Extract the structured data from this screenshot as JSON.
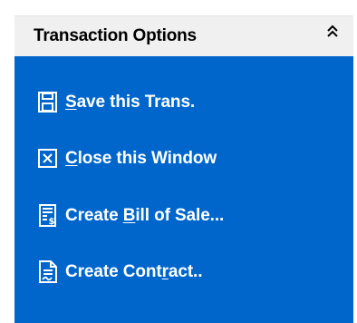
{
  "panel": {
    "title": "Transaction Options",
    "collapse_icon": "double-chevron-up-icon",
    "colors": {
      "header_bg": "#f0f0f0",
      "body_bg": "#0066cc",
      "text": "#ffffff"
    },
    "items": [
      {
        "icon": "save-disk-icon",
        "label": "Save this Trans.",
        "mnemonic_index": 0
      },
      {
        "icon": "close-box-icon",
        "label": "Close this Window",
        "mnemonic_index": 0
      },
      {
        "icon": "invoice-icon",
        "label": "Create Bill of Sale...",
        "mnemonic_index": 7
      },
      {
        "icon": "document-icon",
        "label": "Create Contract..",
        "mnemonic_index": 11
      }
    ]
  }
}
